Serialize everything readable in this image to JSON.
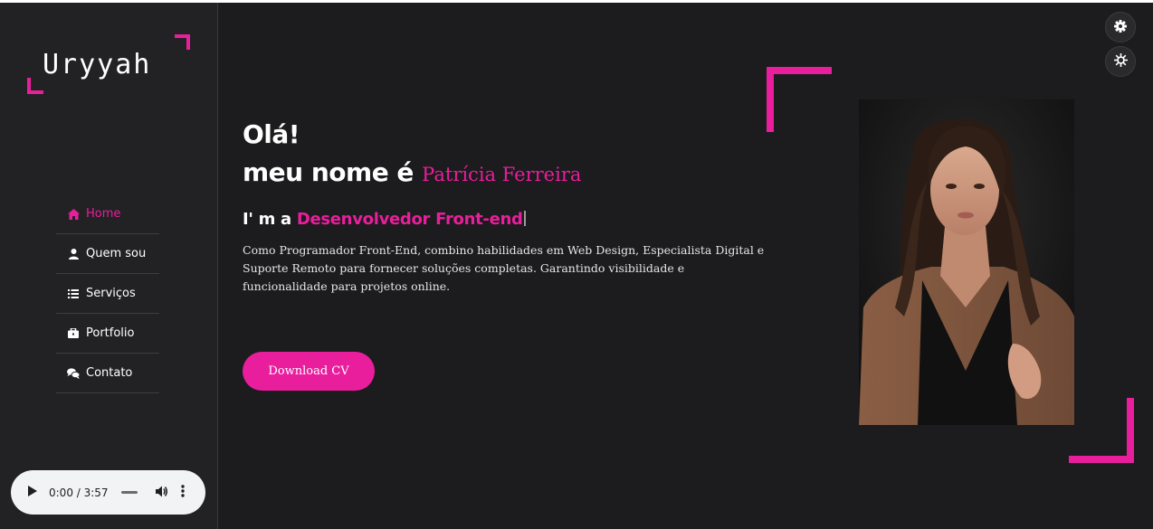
{
  "sidebar": {
    "logo": "Uryyah",
    "nav": [
      {
        "label": "Home",
        "icon": "home-icon",
        "active": true
      },
      {
        "label": "Quem sou",
        "icon": "user-icon",
        "active": false
      },
      {
        "label": "Serviços",
        "icon": "list-icon",
        "active": false
      },
      {
        "label": "Portfolio",
        "icon": "briefcase-icon",
        "active": false
      },
      {
        "label": "Contato",
        "icon": "chat-icon",
        "active": false
      }
    ],
    "audio": {
      "time": "0:00 / 3:57"
    }
  },
  "hero": {
    "greeting": "Olá!",
    "name_prefix": "meu nome é",
    "name": "Patrícia Ferreira",
    "role_prefix": "I' m a",
    "role": "Desenvolvedor Front-end",
    "bio": "Como Programador Front-End, combino habilidades em Web Design, Especialista Digital e Suporte Remoto para fornecer soluções completas. Garantindo visibilidade e funcionalidade para projetos online.",
    "cta": "Download CV"
  },
  "colors": {
    "accent": "#e91e9c",
    "background": "#1c1b1d",
    "sidebar": "#222224"
  },
  "icons": [
    "gear-icon",
    "sun-icon",
    "play-icon",
    "volume-icon",
    "more-vert-icon"
  ]
}
